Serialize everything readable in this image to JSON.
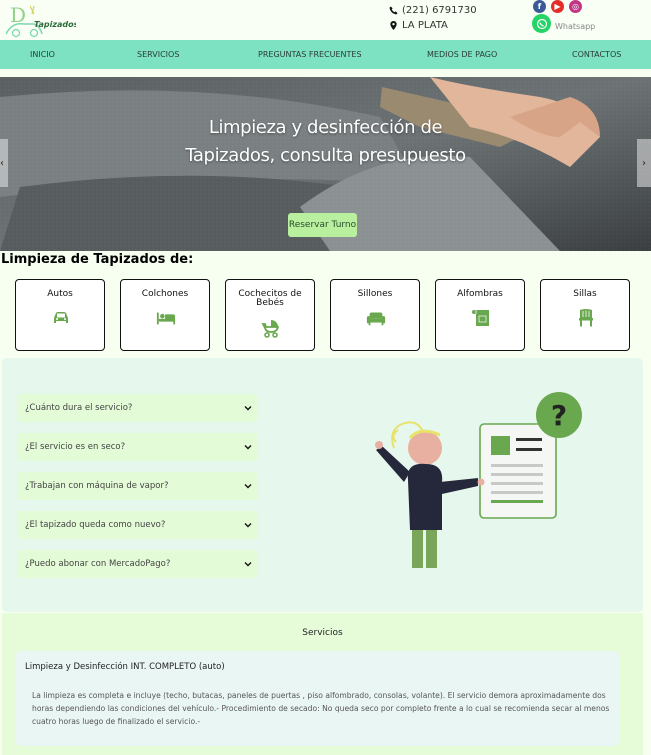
{
  "brand": {
    "logo_text": "Tapizados",
    "logo_letter": "D"
  },
  "contact": {
    "phone": "(221) 6791730",
    "city": "LA PLATA"
  },
  "socials": {
    "facebook_icon": "facebook-icon",
    "youtube_icon": "youtube-icon",
    "instagram_icon": "instagram-icon",
    "whatsapp_label": "Whatsapp"
  },
  "nav": {
    "items": [
      "INICIO",
      "SERVICIOS",
      "PREGUNTAS FRECUENTES",
      "MEDIOS DE PAGO",
      "CONTACTOS"
    ]
  },
  "hero": {
    "title_line1": "Limpieza y desinfección de",
    "title_line2": "Tapizados, consulta presupuesto",
    "cta": "Reservar Turno",
    "prev_arrow": "‹",
    "next_arrow": "›"
  },
  "services": {
    "heading": "Limpieza de Tapizados de:",
    "items": [
      {
        "label": "Autos",
        "icon": "car-icon"
      },
      {
        "label": "Colchones",
        "icon": "bed-icon"
      },
      {
        "label": "Cochecitos de Bebés",
        "icon": "stroller-icon"
      },
      {
        "label": "Sillones",
        "icon": "couch-icon"
      },
      {
        "label": "Alfombras",
        "icon": "carpet-icon"
      },
      {
        "label": "Sillas",
        "icon": "chair-icon"
      }
    ]
  },
  "faq": {
    "questions": [
      "¿Cuánto dura el servicio?",
      "¿El servicio es en seco?",
      "¿Trabajan con máquina de vapor?",
      "¿El tapizado queda como nuevo?",
      "¿Puedo abonar con MercadoPago?"
    ],
    "illustration_mark": "?"
  },
  "servicios_panel": {
    "title": "Servicios",
    "item_title": "Limpieza y Desinfección INT. COMPLETO (auto)",
    "item_text": "La limpieza es completa e incluye (techo, butacas, paneles de puertas , piso alfombrado, consolas, volante). El servicio demora aproximadamente dos horas dependiendo las condiciones del vehículo.- Procedimiento de secado: No queda seco por completo frente a lo cual se recomienda secar al menos cuatro horas luego de finalizado el servicio.-"
  },
  "colors": {
    "nav": "#7de2c2",
    "accent_green": "#6aa84f",
    "cta": "#b8f0a0",
    "faq_bg": "#e6f7ee",
    "question_bg": "#e3fbd6"
  }
}
